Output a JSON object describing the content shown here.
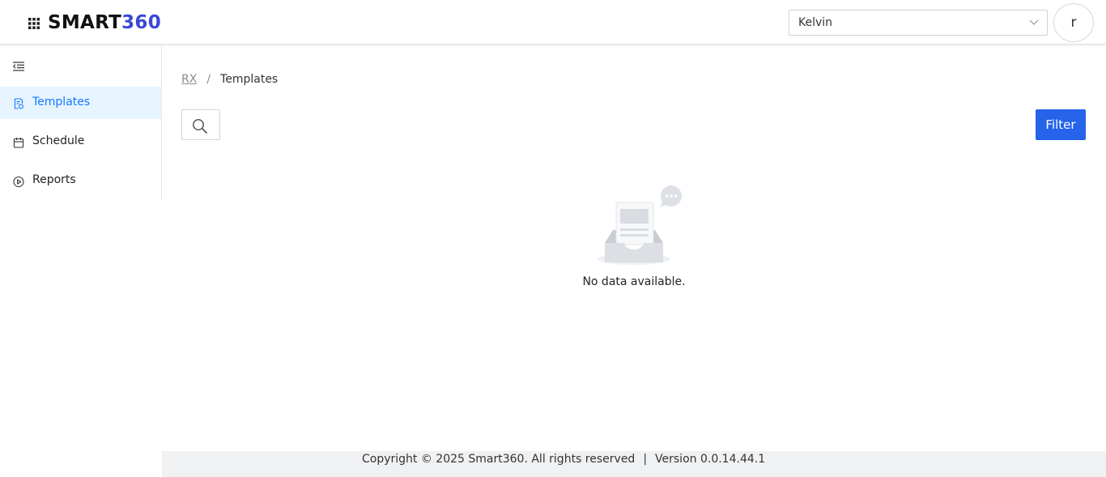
{
  "header": {
    "logo_part1": "SMART",
    "logo_part2": "360",
    "user_select_value": "Kelvin",
    "avatar_initial": "r"
  },
  "sidebar": {
    "items": [
      {
        "label": "Templates",
        "icon": "template-doc-icon",
        "active": true
      },
      {
        "label": "Schedule",
        "icon": "calendar-icon",
        "active": false
      },
      {
        "label": "Reports",
        "icon": "play-circle-icon",
        "active": false
      }
    ]
  },
  "breadcrumb": {
    "root": "RX",
    "separator": "/",
    "current": "Templates"
  },
  "toolbar": {
    "filter_label": "Filter"
  },
  "empty_state": {
    "message": "No data available."
  },
  "footer": {
    "copyright": "Copyright © 2025 Smart360. All rights reserved",
    "separator": "|",
    "version": "Version 0.0.14.44.1"
  },
  "colors": {
    "brand_accent": "#3a47d5",
    "primary_button": "#2563eb",
    "active_nav_bg": "#e6f4ff",
    "active_nav_text": "#1677ff"
  }
}
